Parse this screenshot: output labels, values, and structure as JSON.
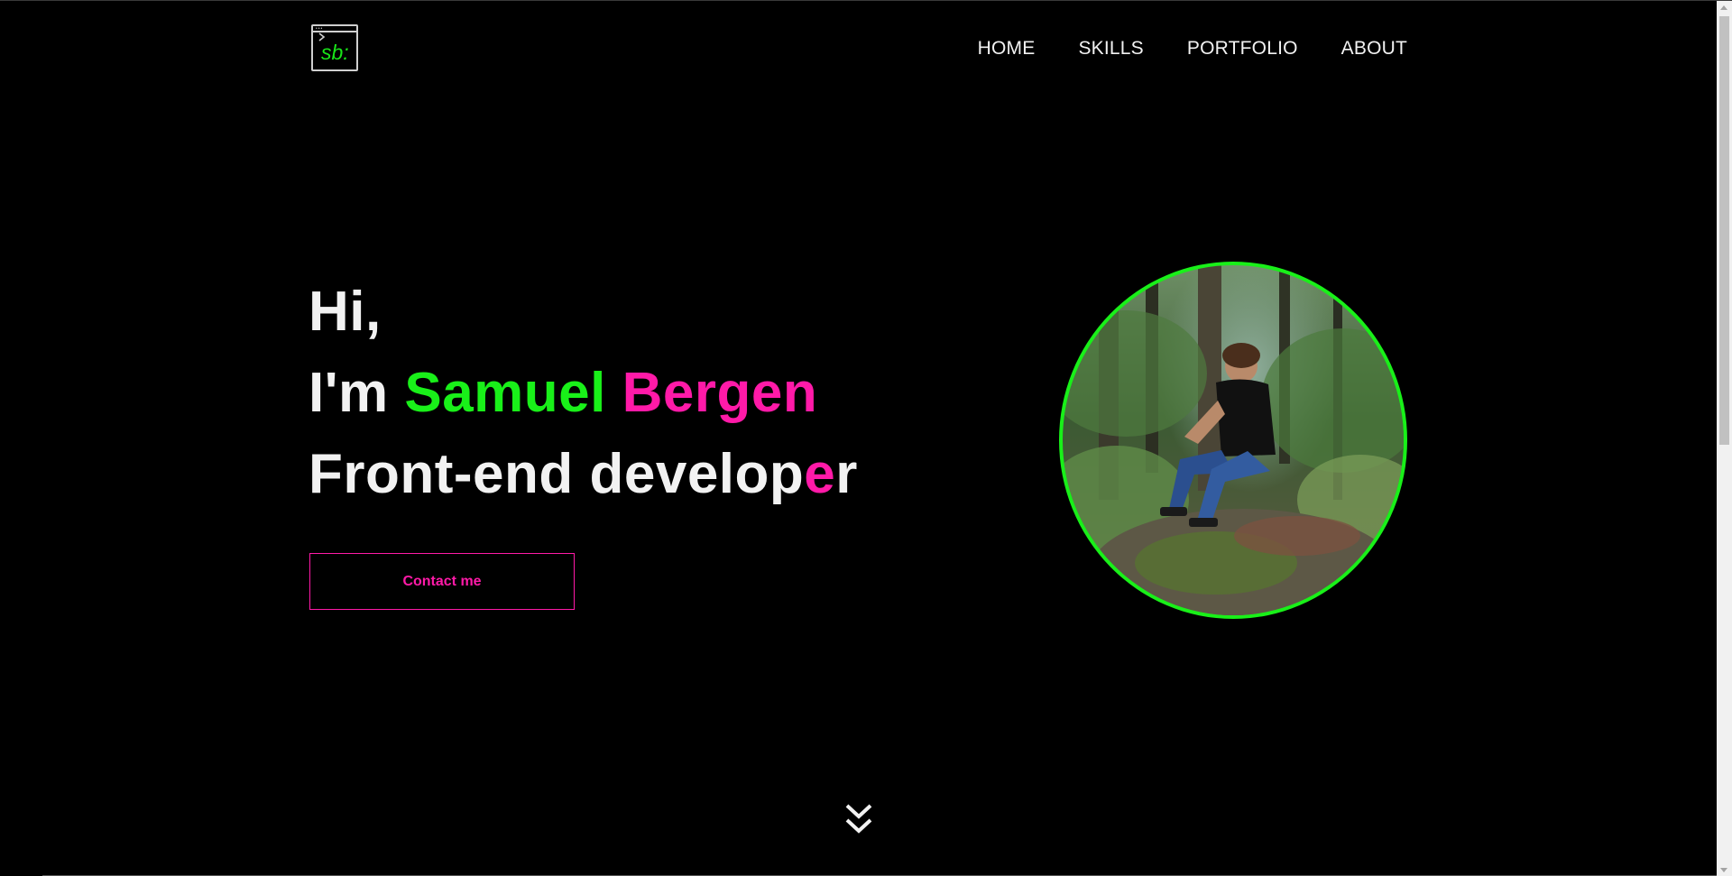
{
  "logo": {
    "text": "sb:"
  },
  "nav": {
    "items": [
      {
        "label": "HOME"
      },
      {
        "label": "SKILLS"
      },
      {
        "label": "PORTFOLIO"
      },
      {
        "label": "ABOUT"
      }
    ]
  },
  "hero": {
    "greeting": "Hi,",
    "intro_prefix": "I'm",
    "first_name": "Samuel",
    "last_name": "Bergen",
    "role_part1": "Front-end develop",
    "role_highlight": "e",
    "role_part2": "r",
    "contact_label": "Contact me"
  },
  "colors": {
    "background": "#000000",
    "accent_green": "#19f019",
    "accent_pink": "#ff1aa8",
    "text": "#f2f2f2"
  },
  "icons": {
    "scroll": "double-chevron-down-icon",
    "logo": "terminal-window-icon"
  }
}
